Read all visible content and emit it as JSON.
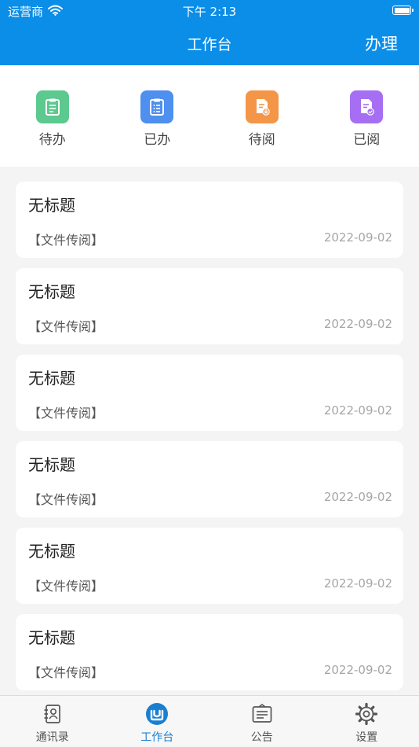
{
  "status_bar": {
    "carrier": "运营商",
    "time": "下午 2:13"
  },
  "navbar": {
    "title": "工作台",
    "action": "办理"
  },
  "quick_actions": [
    {
      "label": "待办",
      "icon": "pending-clipboard-icon",
      "color": "#5cc98f"
    },
    {
      "label": "已办",
      "icon": "done-clipboard-icon",
      "color": "#4e8ff0"
    },
    {
      "label": "待阅",
      "icon": "pending-read-doc-icon",
      "color": "#f39647"
    },
    {
      "label": "已阅",
      "icon": "read-doc-check-icon",
      "color": "#a66ef2"
    }
  ],
  "messages": [
    {
      "title": "无标题",
      "type": "【文件传阅】",
      "date": "2022-09-02"
    },
    {
      "title": "无标题",
      "type": "【文件传阅】",
      "date": "2022-09-02"
    },
    {
      "title": "无标题",
      "type": "【文件传阅】",
      "date": "2022-09-02"
    },
    {
      "title": "无标题",
      "type": "【文件传阅】",
      "date": "2022-09-02"
    },
    {
      "title": "无标题",
      "type": "【文件传阅】",
      "date": "2022-09-02"
    },
    {
      "title": "无标题",
      "type": "【文件传阅】",
      "date": "2022-09-02"
    }
  ],
  "tabs": [
    {
      "label": "通讯录",
      "icon": "contacts-icon",
      "active": false
    },
    {
      "label": "工作台",
      "icon": "workbench-icon",
      "active": true
    },
    {
      "label": "公告",
      "icon": "announcement-icon",
      "active": false
    },
    {
      "label": "设置",
      "icon": "settings-gear-icon",
      "active": false
    }
  ],
  "colors": {
    "header": "#0a8ee8",
    "tab_active": "#1a7fd1",
    "tab_inactive": "#555555"
  }
}
